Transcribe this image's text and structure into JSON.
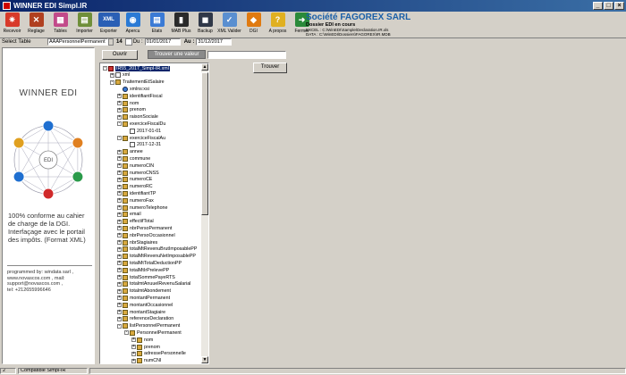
{
  "window": {
    "title": "WINNER EDI Simpl.IR",
    "controls": [
      "_",
      "□",
      "×"
    ]
  },
  "toolbar": {
    "buttons": [
      {
        "label": "Recevoir",
        "icon": "receive-icon",
        "color": "#d83a2a",
        "glyph": "✷"
      },
      {
        "label": "Reglage",
        "icon": "tools-icon",
        "color": "#b04020",
        "glyph": "✕"
      },
      {
        "label": "Tables",
        "icon": "tables-icon",
        "color": "#c24a8a",
        "glyph": "▦"
      },
      {
        "label": "Importer",
        "icon": "import-icon",
        "color": "#6f8f3a",
        "glyph": "▤"
      },
      {
        "label": "Exporter",
        "icon": "xml-export-icon",
        "color": "#2a5fb5",
        "glyph": "XML"
      },
      {
        "label": "Apercu",
        "icon": "preview-icon",
        "color": "#2a7ad5",
        "glyph": "◉"
      },
      {
        "label": "Etats",
        "icon": "reports-icon",
        "color": "#3a7ad5",
        "glyph": "▤"
      },
      {
        "label": "MAB Plus",
        "icon": "mab-icon",
        "color": "#2a2a2a",
        "glyph": "▮"
      },
      {
        "label": "Backup",
        "icon": "backup-icon",
        "color": "#303848",
        "glyph": "◼"
      },
      {
        "label": "XML Valider",
        "icon": "xml-validate-icon",
        "color": "#5a8fd0",
        "glyph": "✓"
      },
      {
        "label": "DGI",
        "icon": "dgi-icon",
        "color": "#e07a10",
        "glyph": "◆"
      },
      {
        "label": "A propos",
        "icon": "about-icon",
        "color": "#e0b020",
        "glyph": "?"
      },
      {
        "label": "Fermer",
        "icon": "exit-icon",
        "color": "#2a8a3a",
        "glyph": "➜"
      }
    ]
  },
  "company": {
    "name": "Société FAGOREX SARL",
    "dossier": "Dossier EDI en cours",
    "excel_label": "EXCEL :",
    "excel_path": "C:\\WinEDI\\Sample\\Declaration.IR.xls",
    "data_label": "DATA :",
    "data_path": "C:\\WinEDI\\Dossiers\\FAGOREX\\IR.MDB"
  },
  "selectbar": {
    "select_label": "Select Table",
    "table_value": "AAAPersonnelPermanent",
    "count": "14",
    "du_label": "Du :",
    "du_value": "01/01/2017",
    "au_label": "Au :",
    "au_value": "31/12/2017"
  },
  "buttons": {
    "ouvrir": "Ouvrir",
    "find_value": "Trouver une valeur",
    "trouver": "Trouver"
  },
  "search": {
    "value": ""
  },
  "left_panel": {
    "title": "WINNER EDI",
    "hub": "EDI",
    "claim": "100% conforme au cahier de charge de la DGI. Interfaçage avec le portail des impôts. (Format XML)",
    "credit_line1": "programmed by: windata sarl ,",
    "credit_line2": "www.novascos.com , mail:",
    "credit_line3": "support@novascos.com ,",
    "credit_line4": "tel: +212655996646",
    "satellite_colors": [
      "#1f6fd0",
      "#e08020",
      "#2a9a4a",
      "#d02a2a",
      "#1f6fd0",
      "#e0a020"
    ]
  },
  "tree": {
    "nodes": [
      {
        "label": "IR55_2017_Simpl-IR.xml",
        "level": 0,
        "exp": "-",
        "icon": "root",
        "sel": true
      },
      {
        "label": "xml",
        "level": 1,
        "exp": "+",
        "icon": "file"
      },
      {
        "label": "TraitementEtSalaire",
        "level": 1,
        "exp": "-",
        "icon": "folder"
      },
      {
        "label": "xmlns:xsi",
        "level": 2,
        "exp": "",
        "icon": "q"
      },
      {
        "label": "identifiantFiscal",
        "level": 2,
        "exp": "+",
        "icon": "folder"
      },
      {
        "label": "nom",
        "level": 2,
        "exp": "+",
        "icon": "folder"
      },
      {
        "label": "prenom",
        "level": 2,
        "exp": "+",
        "icon": "folder"
      },
      {
        "label": "raisonSociale",
        "level": 2,
        "exp": "+",
        "icon": "folder"
      },
      {
        "label": "exerciceFiscalDu",
        "level": 2,
        "exp": "-",
        "icon": "folder"
      },
      {
        "label": "2017-01-01",
        "level": 3,
        "exp": "",
        "icon": "file"
      },
      {
        "label": "exerciceFiscalAu",
        "level": 2,
        "exp": "-",
        "icon": "folder"
      },
      {
        "label": "2017-12-31",
        "level": 3,
        "exp": "",
        "icon": "file"
      },
      {
        "label": "annee",
        "level": 2,
        "exp": "+",
        "icon": "folder"
      },
      {
        "label": "commune",
        "level": 2,
        "exp": "+",
        "icon": "folder"
      },
      {
        "label": "numeroCIN",
        "level": 2,
        "exp": "+",
        "icon": "folder"
      },
      {
        "label": "numeroCNSS",
        "level": 2,
        "exp": "+",
        "icon": "folder"
      },
      {
        "label": "numeroCE",
        "level": 2,
        "exp": "+",
        "icon": "folder"
      },
      {
        "label": "numeroRC",
        "level": 2,
        "exp": "+",
        "icon": "folder"
      },
      {
        "label": "identifiantTP",
        "level": 2,
        "exp": "+",
        "icon": "folder"
      },
      {
        "label": "numeroFax",
        "level": 2,
        "exp": "+",
        "icon": "folder"
      },
      {
        "label": "numeroTelephone",
        "level": 2,
        "exp": "+",
        "icon": "folder"
      },
      {
        "label": "email",
        "level": 2,
        "exp": "+",
        "icon": "folder"
      },
      {
        "label": "effectifTotal",
        "level": 2,
        "exp": "+",
        "icon": "folder"
      },
      {
        "label": "nbrPersoPermanent",
        "level": 2,
        "exp": "+",
        "icon": "folder"
      },
      {
        "label": "nbrPersoOccasionnel",
        "level": 2,
        "exp": "+",
        "icon": "folder"
      },
      {
        "label": "nbrStagiaires",
        "level": 2,
        "exp": "+",
        "icon": "folder"
      },
      {
        "label": "totalMtRevenuBrutImposablePP",
        "level": 2,
        "exp": "+",
        "icon": "folder"
      },
      {
        "label": "totalMtRevenuNetImposablePP",
        "level": 2,
        "exp": "+",
        "icon": "folder"
      },
      {
        "label": "totalMtTotalDeductionPP",
        "level": 2,
        "exp": "+",
        "icon": "folder"
      },
      {
        "label": "totalMtIrPrelevePP",
        "level": 2,
        "exp": "+",
        "icon": "folder"
      },
      {
        "label": "totalSommePayeRTS",
        "level": 2,
        "exp": "+",
        "icon": "folder"
      },
      {
        "label": "totalmtAnuuelRevenuSalarial",
        "level": 2,
        "exp": "+",
        "icon": "folder"
      },
      {
        "label": "totalmtAbondement",
        "level": 2,
        "exp": "+",
        "icon": "folder"
      },
      {
        "label": "montantPermanent",
        "level": 2,
        "exp": "+",
        "icon": "folder"
      },
      {
        "label": "montantOccasionnel",
        "level": 2,
        "exp": "+",
        "icon": "folder"
      },
      {
        "label": "montantStagiaire",
        "level": 2,
        "exp": "+",
        "icon": "folder"
      },
      {
        "label": "referenceDeclaration",
        "level": 2,
        "exp": "+",
        "icon": "folder"
      },
      {
        "label": "listPersonnelPermanent",
        "level": 2,
        "exp": "-",
        "icon": "folder"
      },
      {
        "label": "PersonnelPermanent",
        "level": 3,
        "exp": "-",
        "icon": "folder"
      },
      {
        "label": "nom",
        "level": 4,
        "exp": "+",
        "icon": "folder"
      },
      {
        "label": "prenom",
        "level": 4,
        "exp": "+",
        "icon": "folder"
      },
      {
        "label": "adressePersonnelle",
        "level": 4,
        "exp": "+",
        "icon": "folder"
      },
      {
        "label": "numCNI",
        "level": 4,
        "exp": "+",
        "icon": "folder"
      }
    ]
  },
  "statusbar": {
    "cell1": "2",
    "cell2": "Compatible Simpl-IR"
  }
}
